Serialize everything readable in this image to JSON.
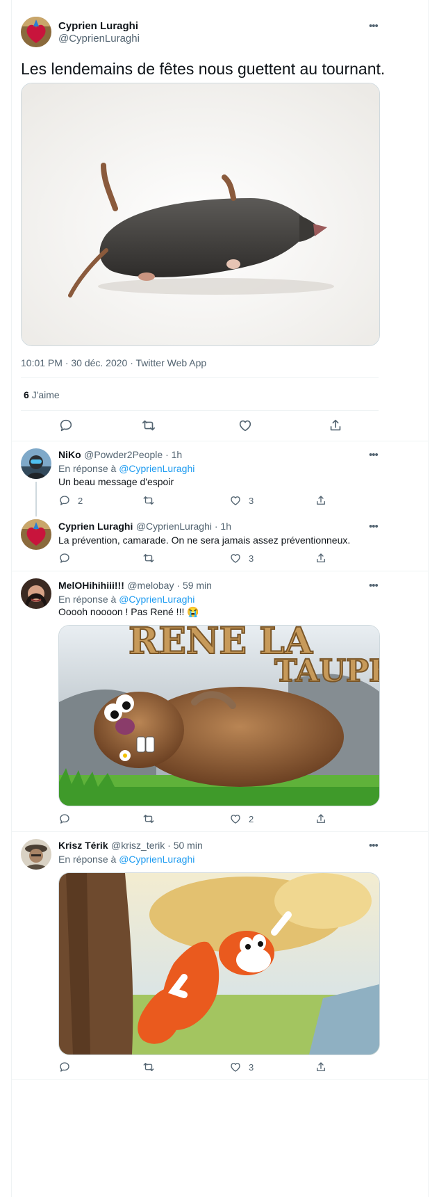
{
  "main_tweet": {
    "author_name": "Cyprien Luraghi",
    "author_handle": "@CyprienLuraghi",
    "text": "Les lendemains de fêtes nous guettent au tournant.",
    "timestamp": "10:01 PM · 30 déc. 2020",
    "source": "Twitter Web App",
    "likes_count": "6",
    "likes_label": "J'aime"
  },
  "replies": [
    {
      "author_name": "NiKo",
      "author_handle": "@Powder2People",
      "time": "1h",
      "reply_to_prefix": "En réponse à",
      "reply_to": "@CyprienLuraghi",
      "text": "Un beau message d'espoir",
      "reply_count": "2",
      "retweet_count": "",
      "like_count": "3"
    },
    {
      "author_name": "Cyprien Luraghi",
      "author_handle": "@CyprienLuraghi",
      "time": "1h",
      "text": "La prévention, camarade. On ne sera jamais assez préventionneux.",
      "reply_count": "",
      "retweet_count": "",
      "like_count": "3"
    },
    {
      "author_name": "MelOHihihiii!!!",
      "author_handle": "@melobay",
      "time": "59 min",
      "reply_to_prefix": "En réponse à",
      "reply_to": "@CyprienLuraghi",
      "text": "Ooooh noooon ! Pas René !!! 😭",
      "image_text_1": "RENE LA",
      "image_text_2": "TAUPE",
      "reply_count": "",
      "retweet_count": "",
      "like_count": "2"
    },
    {
      "author_name": "Krisz Térik",
      "author_handle": "@krisz_terik",
      "time": "50 min",
      "reply_to_prefix": "En réponse à",
      "reply_to": "@CyprienLuraghi",
      "reply_count": "",
      "retweet_count": "",
      "like_count": "3"
    }
  ],
  "separator": " · ",
  "more_label": "•••",
  "icons": [
    "more-icon",
    "reply-icon",
    "retweet-icon",
    "like-icon",
    "share-icon"
  ],
  "colors": {
    "link": "#1d9bf0",
    "secondary_text": "#536471",
    "border": "#eff3f4"
  }
}
